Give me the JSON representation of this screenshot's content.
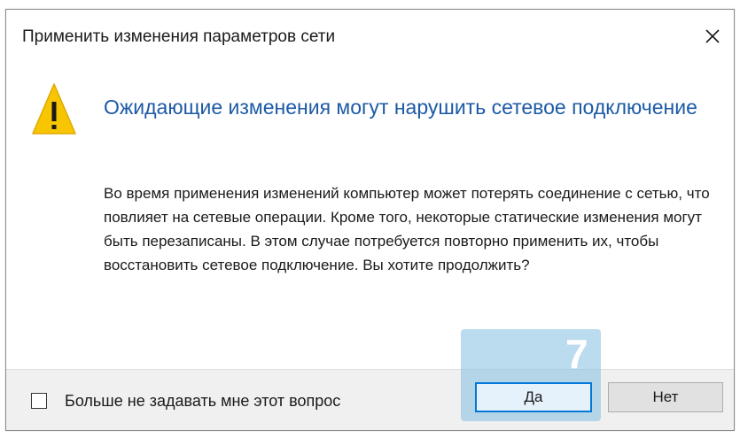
{
  "dialog": {
    "title": "Применить изменения параметров сети",
    "close_icon": "close-icon",
    "warning_icon": "warning-icon",
    "main_instruction": "Ожидающие изменения могут нарушить сетевое подключение",
    "content": "Во время применения изменений компьютер может потерять соединение с сетью, что повлияет на сетевые операции. Кроме того, некоторые статические изменения могут быть перезаписаны. В этом случае потребуется повторно применить их, чтобы восстановить сетевое подключение. Вы хотите продолжить?"
  },
  "footer": {
    "checkbox_label": "Больше не задавать мне этот вопрос",
    "checkbox_checked": false,
    "yes_label": "Да",
    "no_label": "Нет"
  },
  "annotation": {
    "step": "7",
    "highlight_color": "#84bee0"
  },
  "colors": {
    "instruction": "#1c5aa6",
    "focus_border": "#0078d7",
    "warning_fill": "#f7c600"
  }
}
